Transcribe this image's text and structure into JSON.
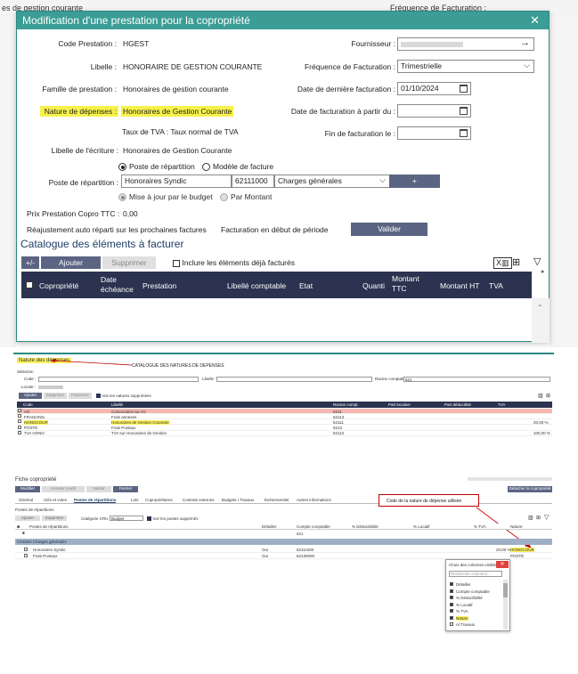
{
  "background": {
    "left_text": "es de gestion courante",
    "right_text": "Fréquence de Facturation :"
  },
  "modal": {
    "title": "Modification d'une prestation pour la copropriété",
    "close_icon": "close-icon",
    "code_label": "Code Prestation :",
    "code_value": "HGEST",
    "fournisseur_label": "Fournisseur :",
    "fournisseur_value": "",
    "libelle_label": "Libelle :",
    "libelle_value": "HONORAIRE DE GESTION COURANTE",
    "frequence_label": "Fréquence de Facturation :",
    "frequence_value": "Trimestrielle",
    "famille_label": "Famille de prestation :",
    "famille_value": "Honoraires de gestion courante",
    "derniere_label": "Date de dernière facturation :",
    "derniere_value": "01/10/2024",
    "nature_label": "Nature de dépenses :",
    "nature_value": "Honoraires de Gestion Courante",
    "apartir_label": "Date de facturation à partir du :",
    "apartir_value": "",
    "tva_text": "Taux de TVA : Taux normal de TVA",
    "fin_label": "Fin de facturation le :",
    "fin_value": "",
    "libecr_label": "Libelle de l'écriture :",
    "libecr_value": "Honoraires de Gestion Courante",
    "radio_poste": "Poste de répartition",
    "radio_modele": "Modèle de facture",
    "poste_label": "Poste de répartition :",
    "poste_name": "Honoraires Syndic",
    "poste_code": "62111000",
    "poste_cat": "Charges générales",
    "plus_label": "+",
    "radio_budget": "Mise à jour par le budget",
    "radio_montant": "Par Montant",
    "prix_label": "Prix Prestation Copro TTC :",
    "prix_value": "0,00",
    "reajust_label": "Réajustement auto réparti sur les prochaines factures",
    "debut_label": "Facturation en début de période",
    "valider_label": "Valider",
    "catalogue_title": "Catalogue des éléments à facturer",
    "btn_plusminus": "+/-",
    "btn_ajouter": "Ajouter",
    "btn_supprimer": "Supprimer",
    "inclure_label": "Inclure les éléments déjà facturés",
    "columns": [
      "Copropriété",
      "Date échéance",
      "Prestation",
      "Libellé comptable",
      "Etat",
      "Quanti",
      "Montant TTC",
      "Montant HT",
      "TVA"
    ]
  },
  "s2": {
    "title": "Nature des dépenses",
    "annotation": "CATALOGUE DES NATURES DE DEPENSES",
    "selection": "Sélection",
    "code_label": "Code :",
    "libelle_label": "Libelle :",
    "racine_label": "Racine comptable :",
    "racine_value": "621",
    "locate_label": "Locate :",
    "btn_ajouter": "Ajouter",
    "btn_supprimer": "Supprimer",
    "btn_fusionner": "Fusionner",
    "voir_label": "Voir les natures supprimées",
    "columns": [
      "Code",
      "Libellé",
      "Racine compt.",
      "Part locative",
      "Part déductible",
      "TVA"
    ],
    "rows": [
      {
        "code": "AG",
        "libelle": "Convocation au AG",
        "racine": "6211",
        "tva": ""
      },
      {
        "code": "FRAISANN",
        "libelle": "Frais annexes",
        "racine": "62113",
        "tva": ""
      },
      {
        "code": "HONOCOUR",
        "libelle": "Honoraires de Gestion Courante",
        "racine": "62111",
        "tva": "20,00 %"
      },
      {
        "code": "POSTE",
        "libelle": "Frais Postaux",
        "racine": "6213",
        "tva": ""
      },
      {
        "code": "TVA HONO",
        "libelle": "TVA sur Honoraires de Gestion",
        "racine": "62112",
        "tva": "100,00 %"
      }
    ]
  },
  "s3": {
    "title": "Fiche copropriété",
    "btn_modifier": "Modifier",
    "btn_annuler": "Annuler modif",
    "btn_valider": "Valider",
    "btn_fermer": "Fermer",
    "btn_detacher": "Détacher la copropriété",
    "tabs": [
      "Général",
      "Clés et votes",
      "Postes de répartitions",
      "Lots",
      "Copropriétaires",
      "Contrats externes",
      "Budgets / Travaux",
      "Événementiel",
      "Autres informations"
    ],
    "annotation": "Code de la nature de dépense utilisée",
    "section_label": "Postes de répartitions",
    "btn_ajouter": "Ajouter",
    "btn_supprimer": "Supprimer",
    "categorie_label": "Catégorie CRU :",
    "categorie_value": "Budget",
    "voir_label": "Voir les postes supprimés",
    "columns": [
      "Postes de répartitions",
      "Détailler",
      "Compte comptable",
      "% Déductibilité",
      "% Locatif",
      "% TVA",
      "Nature"
    ],
    "filter_value": "621",
    "group_label": "CGGEN  Charges générales",
    "rows": [
      {
        "name": "Honoraires Syndic",
        "detailler": "Oui",
        "compte": "62111000",
        "tva": "20,00 %",
        "nature": "HONOCOUR"
      },
      {
        "name": "Frais Postaux",
        "detailler": "Oui",
        "compte": "62130000",
        "tva": "",
        "nature": "POSTE"
      }
    ],
    "popup_title": "Choix des colonnes visibles",
    "popup_search": "Recherche colonnes...",
    "popup_items": [
      "Détailler",
      "Compte comptable",
      "% Déductibilité",
      "% Locatif",
      "% TVA",
      "Nature",
      "Al Travaux"
    ]
  }
}
